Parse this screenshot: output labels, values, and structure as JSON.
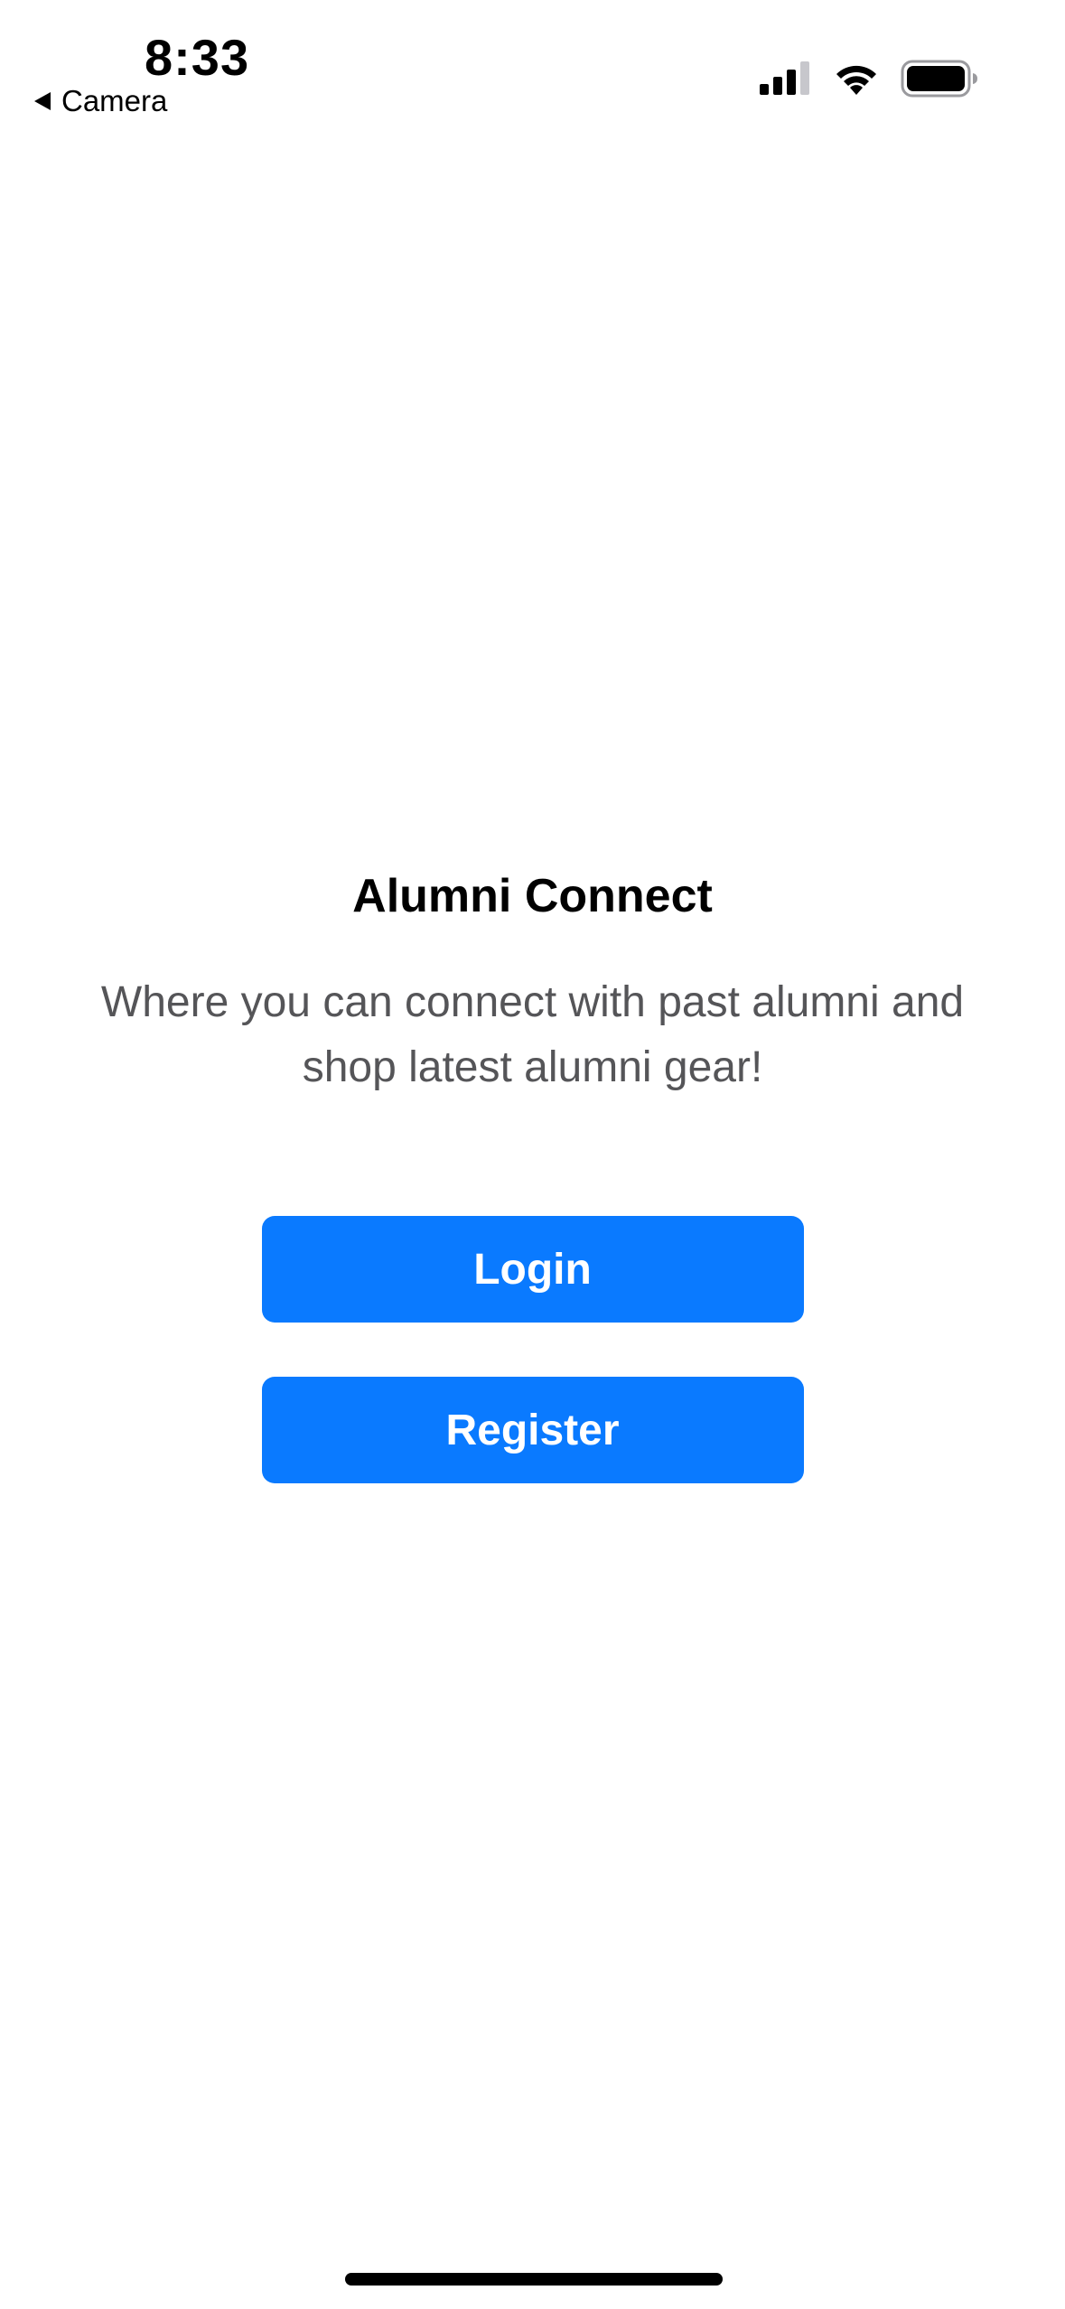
{
  "status_bar": {
    "time": "8:33",
    "back_label": "Camera",
    "icons": [
      "signal-icon",
      "wifi-icon",
      "battery-icon"
    ]
  },
  "main": {
    "title": "Alumni Connect",
    "subtitle": "Where you can connect with past alumni and shop latest alumni gear!",
    "login_label": "Login",
    "register_label": "Register"
  },
  "colors": {
    "accent": "#0a7aff",
    "subtitle_text": "#555558",
    "background": "#ffffff"
  }
}
